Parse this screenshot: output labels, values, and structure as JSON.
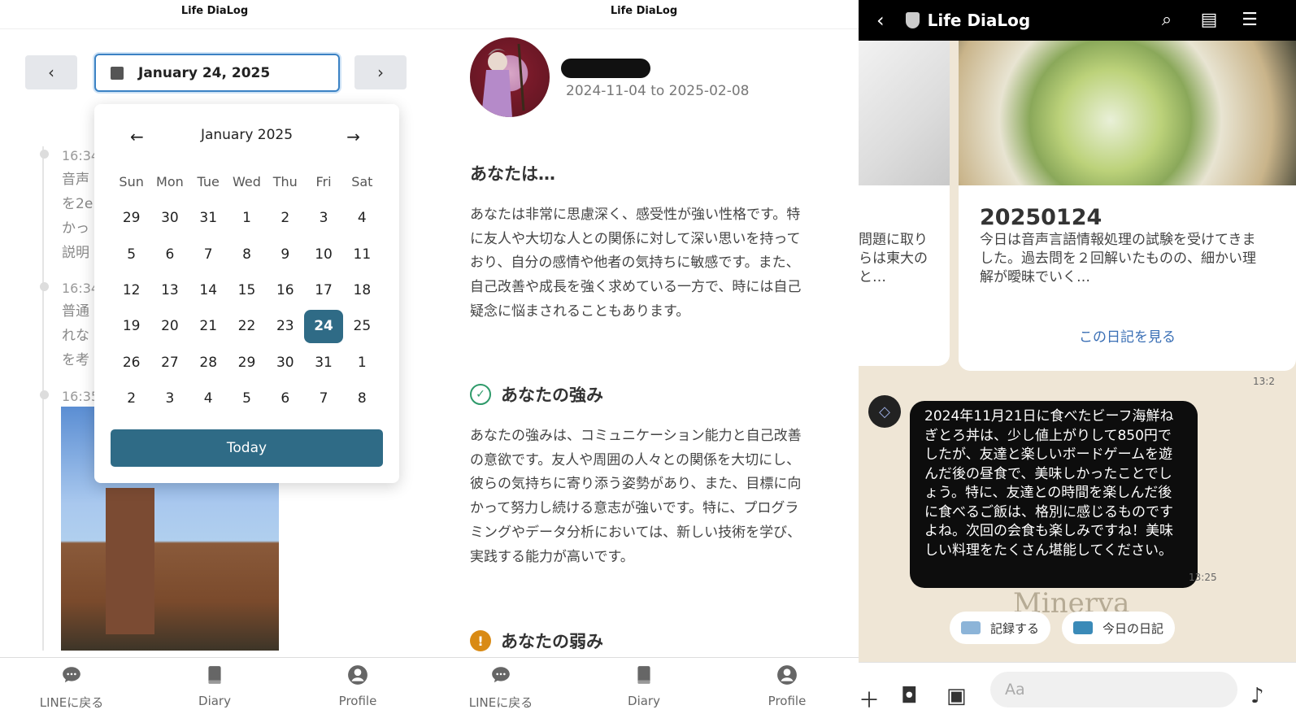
{
  "panel1": {
    "app_title": "Life DiaLog",
    "date_field": "January 24, 2025",
    "prev_label": "‹",
    "next_label": "›",
    "calendar": {
      "month_label": "January 2025",
      "prev_month": "←",
      "next_month": "→",
      "weekdays": [
        "Sun",
        "Mon",
        "Tue",
        "Wed",
        "Thu",
        "Fri",
        "Sat"
      ],
      "days": [
        "29",
        "30",
        "31",
        "1",
        "2",
        "3",
        "4",
        "5",
        "6",
        "7",
        "8",
        "9",
        "10",
        "11",
        "12",
        "13",
        "14",
        "15",
        "16",
        "17",
        "18",
        "19",
        "20",
        "21",
        "22",
        "23",
        "24",
        "25",
        "26",
        "27",
        "28",
        "29",
        "30",
        "31",
        "1",
        "2",
        "3",
        "4",
        "5",
        "6",
        "7",
        "8"
      ],
      "selected": "24",
      "today_button": "Today"
    },
    "entries": [
      {
        "time": "16:34",
        "text": "音声\nを2e\nかっ\n説明"
      },
      {
        "time": "16:34",
        "text": "普通\nれな\nを考"
      },
      {
        "time": "16:35",
        "text": ""
      }
    ]
  },
  "panel2": {
    "app_title": "Life DiaLog",
    "range": "2024-11-04 to 2025-02-08",
    "section1_title": "あなたは…",
    "section1_body": "あなたは非常に思慮深く、感受性が強い性格です。特に友人や大切な人との関係に対して深い思いを持っており、自分の感情や他者の気持ちに敏感です。また、自己改善や成長を強く求めている一方で、時には自己疑念に悩まされることもあります。",
    "section2_title": "あなたの強み",
    "section2_body": "あなたの強みは、コミュニケーション能力と自己改善の意欲です。友人や周囲の人々との関係を大切にし、彼らの気持ちに寄り添う姿勢があり、また、目標に向かって努力し続ける意志が強いです。特に、プログラミングやデータ分析においては、新しい技術を学び、実践する能力が高いです。",
    "section3_title": "あなたの弱み"
  },
  "nav": {
    "line": "LINEに戻る",
    "diary": "Diary",
    "profile": "Profile"
  },
  "panel3": {
    "title": "Life DiaLog",
    "card_left_text": "問題に取り\nらは東大の\nと…",
    "card_date": "20250124",
    "card_text": "今日は音声言語情報処理の試験を受けてきました。過去問を２回解いたものの、細かい理解が曖昧でいく…",
    "card_link": "この日記を見る",
    "ts_top": "13:2",
    "message": "2024年11月21日に食べたビーフ海鮮ねぎとろ丼は、少し値上がりして850円でしたが、友達と楽しいボードゲームを遊んだ後の昼食で、美味しかったことでしょう。特に、友達との時間を楽しんだ後に食べるご飯は、格別に感じるものですよね。次回の会食も楽しみですね！美味しい料理をたくさん堪能してください。",
    "ts_msg": "13:25",
    "watermark": "Minerva",
    "quick_record": "記録する",
    "quick_diary": "今日の日記",
    "input_placeholder": "Aa"
  }
}
